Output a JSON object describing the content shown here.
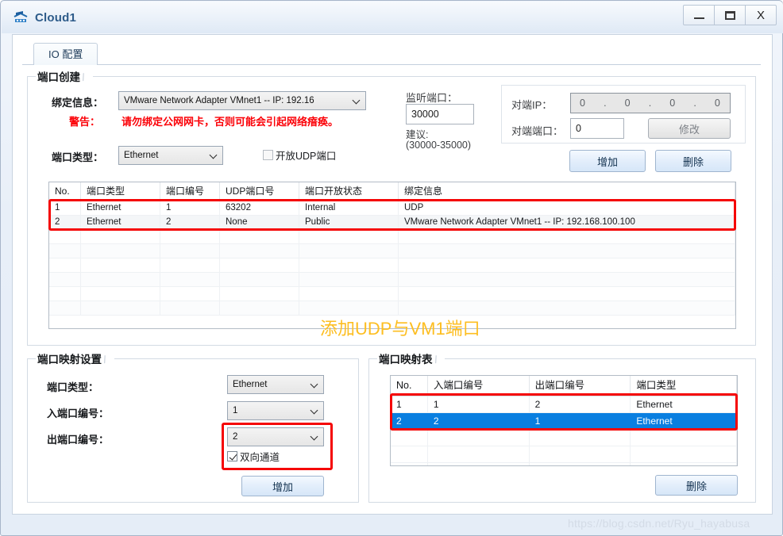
{
  "window": {
    "title": "Cloud1",
    "icon": "cloud-network-icon",
    "controls": {
      "minimize": "–",
      "maximize": "□",
      "close": "X"
    }
  },
  "tabs": [
    {
      "label": "IO 配置",
      "active": true
    }
  ],
  "port_create": {
    "title": "端口创建",
    "bind_info_label": "绑定信息：",
    "bind_info_value": "VMware Network Adapter VMnet1 -- IP: 192.16",
    "warning_label": "警告：",
    "warning_text": "请勿绑定公网网卡，否则可能会引起网络瘖痪。",
    "warning_color": "#fb0007",
    "port_type_label": "端口类型：",
    "port_type_value": "Ethernet",
    "open_udp_label": "开放UDP端口",
    "open_udp_checked": false,
    "listen_port_label": "监听端口：",
    "listen_port_value": "30000",
    "suggest_label": "建议:",
    "suggest_range": "(30000-35000)",
    "peer_ip_label": "对端IP：",
    "peer_ip_octets": [
      "0",
      "0",
      "0",
      "0"
    ],
    "peer_port_label": "对端端口：",
    "peer_port_value": "0",
    "modify_button": "修改",
    "add_button": "增加",
    "delete_button": "删除"
  },
  "port_table": {
    "columns": [
      "No.",
      "端口类型",
      "端口编号",
      "UDP端口号",
      "端口开放状态",
      "绑定信息"
    ],
    "rows": [
      [
        "1",
        "Ethernet",
        "1",
        "63202",
        "Internal",
        "UDP"
      ],
      [
        "2",
        "Ethernet",
        "2",
        "None",
        "Public",
        "VMware Network Adapter VMnet1 -- IP: 192.168.100.100"
      ]
    ],
    "empty_rows": 6,
    "annotation": "添加UDP与VM1端口",
    "annotation_color": "#fdbe21",
    "highlight_color": "#f50505"
  },
  "map_settings": {
    "title": "端口映射设置",
    "port_type_label": "端口类型：",
    "port_type_value": "Ethernet",
    "in_port_label": "入端口编号：",
    "in_port_value": "1",
    "out_port_label": "出端口编号：",
    "out_port_value": "2",
    "bidirectional_label": "双向通道",
    "bidirectional_checked": true,
    "add_button": "增加"
  },
  "map_table": {
    "title": "端口映射表",
    "columns": [
      "No.",
      "入端口编号",
      "出端口编号",
      "端口类型"
    ],
    "rows": [
      {
        "cells": [
          "1",
          "1",
          "2",
          "Ethernet"
        ],
        "selected": false
      },
      {
        "cells": [
          "2",
          "2",
          "1",
          "Ethernet"
        ],
        "selected": true
      }
    ],
    "empty_rows": 3,
    "delete_button": "删除",
    "selection_color": "#0a7fe0"
  },
  "watermark": "https://blog.csdn.net/Ryu_hayabusa"
}
